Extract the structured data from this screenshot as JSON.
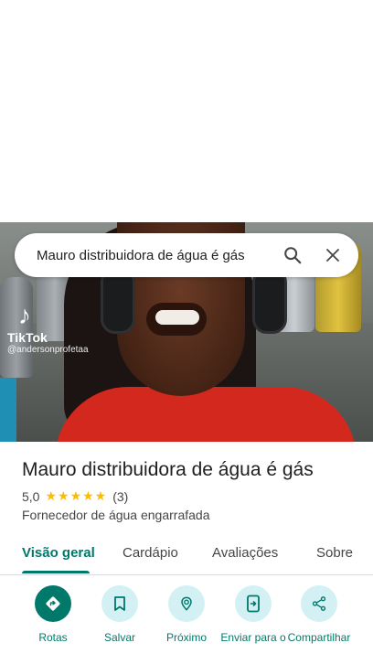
{
  "search": {
    "query": "Mauro distribuidora de água é gás"
  },
  "photo": {
    "watermark_brand": "TikTok",
    "watermark_handle": "@andersonprofetaa"
  },
  "place": {
    "name": "Mauro distribuidora de água é gás",
    "rating": "5,0",
    "stars": "★★★★★",
    "review_count": "(3)",
    "category": "Fornecedor de água engarrafada"
  },
  "tabs": [
    {
      "label": "Visão geral",
      "active": true
    },
    {
      "label": "Cardápio",
      "active": false
    },
    {
      "label": "Avaliações",
      "active": false
    },
    {
      "label": "Sobre",
      "active": false
    }
  ],
  "actions": [
    {
      "label": "Rotas",
      "icon": "directions-icon"
    },
    {
      "label": "Salvar",
      "icon": "bookmark-icon"
    },
    {
      "label": "Próximo",
      "icon": "nearby-icon"
    },
    {
      "label": "Enviar para o",
      "icon": "send-to-phone-icon"
    },
    {
      "label": "Compartilhar",
      "icon": "share-icon"
    }
  ],
  "colors": {
    "accent": "#00796b",
    "star": "#fbbc04",
    "action_bg": "#d3f1f4"
  }
}
